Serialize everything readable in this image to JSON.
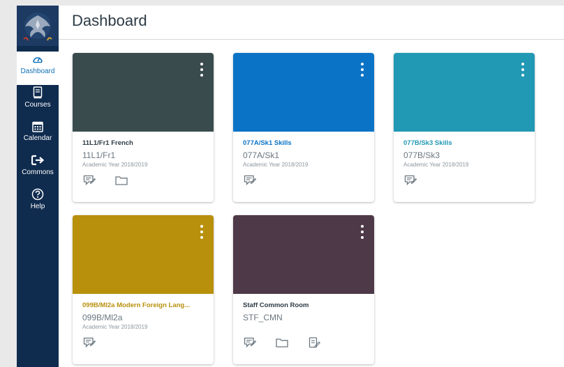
{
  "app": {
    "title": "Dashboard"
  },
  "sidebar": {
    "items": [
      {
        "label": "Dashboard",
        "icon": "dashboard-icon",
        "active": true
      },
      {
        "label": "Courses",
        "icon": "courses-icon"
      },
      {
        "label": "Calendar",
        "icon": "calendar-icon"
      },
      {
        "label": "Commons",
        "icon": "commons-icon"
      },
      {
        "label": "Help",
        "icon": "help-icon"
      }
    ]
  },
  "cards": [
    {
      "title": "11L1/Fr1 French",
      "code": "11L1/Fr1",
      "term": "Academic Year 2018/2019",
      "color": "#394b4d",
      "title_color": "#2d3b45",
      "actions": [
        "announcements-icon",
        "files-icon"
      ]
    },
    {
      "title": "077A/Sk1 Skills",
      "code": "077A/Sk1",
      "term": "Academic Year 2018/2019",
      "color": "#0b73c6",
      "title_color": "#0b73c6",
      "actions": [
        "announcements-icon"
      ]
    },
    {
      "title": "077B/Sk3 Skills",
      "code": "077B/Sk3",
      "term": "Academic Year 2018/2019",
      "color": "#2198b4",
      "title_color": "#2198b4",
      "actions": [
        "announcements-icon"
      ]
    },
    {
      "title": "099B/Ml2a Modern Foreign Lang...",
      "code": "099B/Ml2a",
      "term": "Academic Year 2018/2019",
      "color": "#b8900c",
      "title_color": "#b8900c",
      "actions": [
        "announcements-icon"
      ]
    },
    {
      "title": "Staff Common Room",
      "code": "STF_CMN",
      "term": "",
      "color": "#4e3948",
      "title_color": "#2d3b45",
      "actions": [
        "announcements-icon",
        "files-icon",
        "assignments-icon"
      ]
    }
  ]
}
